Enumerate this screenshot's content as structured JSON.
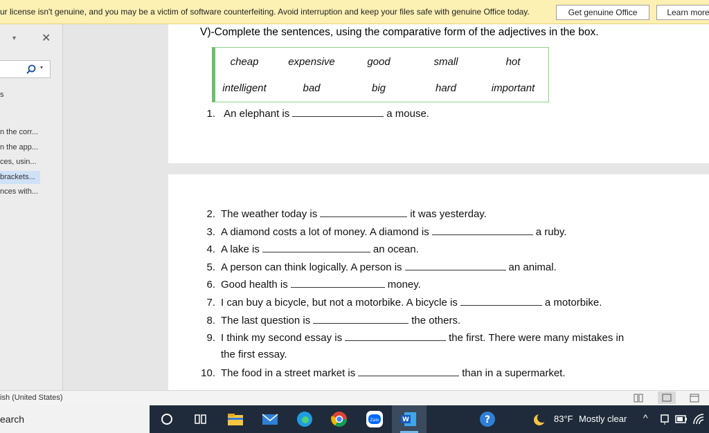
{
  "banner": {
    "message": "ur license isn't genuine, and you may be a victim of software counterfeiting. Avoid interruption and keep your files safe with genuine Office today.",
    "get_genuine_label": "Get genuine Office",
    "learn_more_label": "Learn more"
  },
  "nav": {
    "items": [
      "s",
      "n the corr...",
      "n the app...",
      "ces, usin...",
      "brackets...",
      "nces with..."
    ]
  },
  "doc": {
    "heading": "V)-Complete the sentences, using the comparative form of the adjectives in the box.",
    "word_box": {
      "row1": [
        "cheap",
        "expensive",
        "good",
        "small",
        "hot"
      ],
      "row2": [
        "intelligent",
        "bad",
        "big",
        "hard",
        "important"
      ]
    },
    "q1": {
      "num": "1.",
      "before": "An elephant is",
      "after": "a mouse."
    },
    "questions": [
      {
        "num": "2.",
        "before": "The weather today is",
        "after": "it was yesterday."
      },
      {
        "num": "3.",
        "before": "A diamond costs a lot of money. A diamond is",
        "after": "a ruby."
      },
      {
        "num": "4.",
        "before": "A lake is",
        "after": "an ocean."
      },
      {
        "num": "5.",
        "before": "A person can think logically. A person is",
        "after": "an animal."
      },
      {
        "num": "6.",
        "before": "Good health is",
        "after": "money."
      },
      {
        "num": "7.",
        "before": "I can buy a bicycle, but not a motorbike. A bicycle is",
        "after": "a motorbike."
      },
      {
        "num": "8.",
        "before": "The last question is",
        "after": "the others."
      },
      {
        "num": "9.",
        "before": "I think my second essay is",
        "after": "the first. There were many mistakes in"
      },
      {
        "num": "",
        "before": "the first essay.",
        "after": ""
      },
      {
        "num": "10.",
        "before": "The food in a street market is",
        "after": "than in a supermarket."
      }
    ]
  },
  "status": {
    "language": "ish (United States)"
  },
  "taskbar": {
    "search_label": "earch",
    "weather_temp": "83°F",
    "weather_desc": "Mostly clear"
  }
}
